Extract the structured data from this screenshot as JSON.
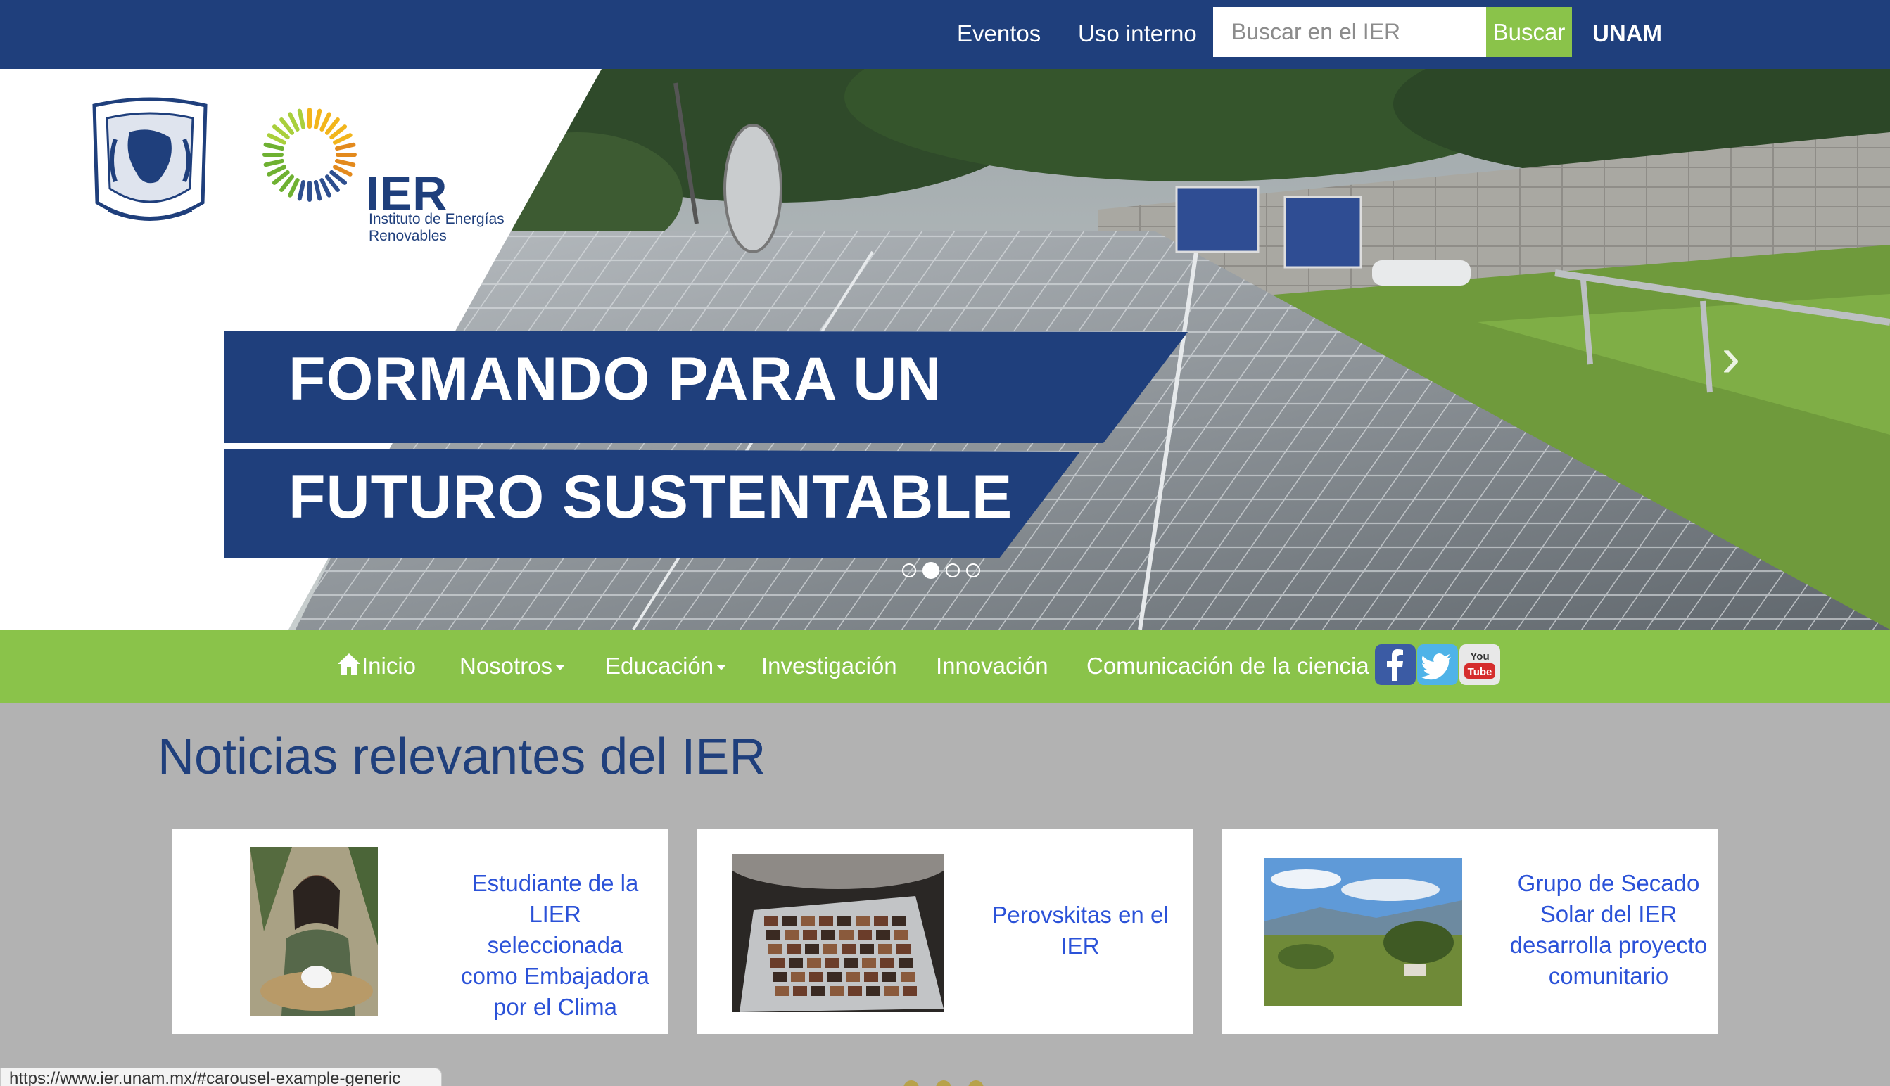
{
  "topbar": {
    "links": [
      "Eventos",
      "Uso interno"
    ],
    "search_placeholder": "Buscar en el IER",
    "search_button": "Buscar",
    "unam": "UNAM"
  },
  "hero": {
    "logo_title": "IER",
    "logo_sub1": "Instituto de Energías",
    "logo_sub2": "Renovables",
    "caption_line1": "FORMANDO PARA UN",
    "caption_line2": "FUTURO SUSTENTABLE",
    "slides_count": 4,
    "active_slide": 2
  },
  "nav": {
    "inicio": "Inicio",
    "nosotros": "Nosotros",
    "educacion": "Educación",
    "investigacion": "Investigación",
    "innovacion": "Innovación",
    "comunicacion": "Comunicación de la ciencia"
  },
  "news": {
    "heading": "Noticias relevantes del IER",
    "items": [
      {
        "title": "Estudiante de la LIER seleccionada como Embajadora por el Clima"
      },
      {
        "title": "Perovskitas en el IER"
      },
      {
        "title": "Grupo de Secado Solar del IER desarrolla proyecto comunitario"
      }
    ]
  },
  "status_url": "https://www.ier.unam.mx/#carousel-example-generic",
  "colors": {
    "navy": "#1f3f7c",
    "green": "#8ac34a",
    "link_blue": "#2b52d8",
    "page_bg": "#b2b2b2"
  }
}
